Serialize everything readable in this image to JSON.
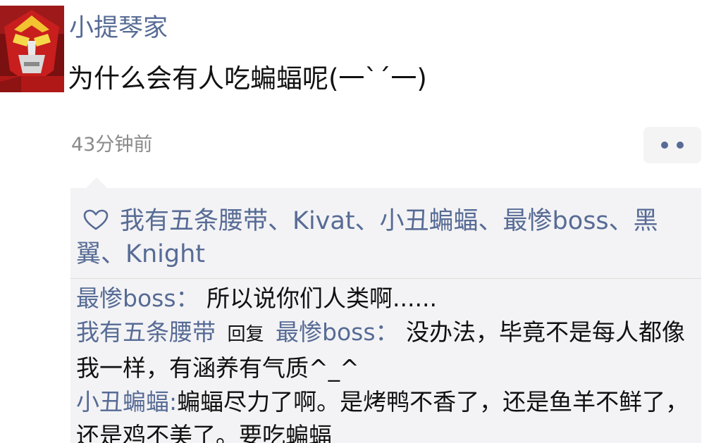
{
  "post": {
    "username": "小提琴家",
    "content": "为什么会有人吃蝙蝠呢(一`´一)",
    "timestamp": "43分钟前",
    "more_icon": "more-dots-icon"
  },
  "likes": {
    "icon": "heart-outline-icon",
    "names_text": "我有五条腰带、Kivat、小丑蝙蝠、最惨boss、黑翼、Knight"
  },
  "comments": [
    {
      "author": "最惨boss",
      "separator": "：",
      "text": "所以说你们人类啊......"
    },
    {
      "author": "我有五条腰带",
      "reply_word": "回复",
      "reply_to": "最惨boss",
      "separator": "：",
      "text": "没办法，毕竟不是每人都像我一样，有涵养有气质^_^"
    },
    {
      "author": "小丑蝙蝠",
      "separator": ":",
      "text": "蝙蝠尽力了啊。是烤鸭不香了，还是鱼羊不鲜了，还是鸡不美了。要吃蝙蝠"
    }
  ],
  "colors": {
    "link": "#576b95",
    "text": "#111111",
    "muted": "#8a8a8a",
    "panel": "#f3f3f5"
  }
}
